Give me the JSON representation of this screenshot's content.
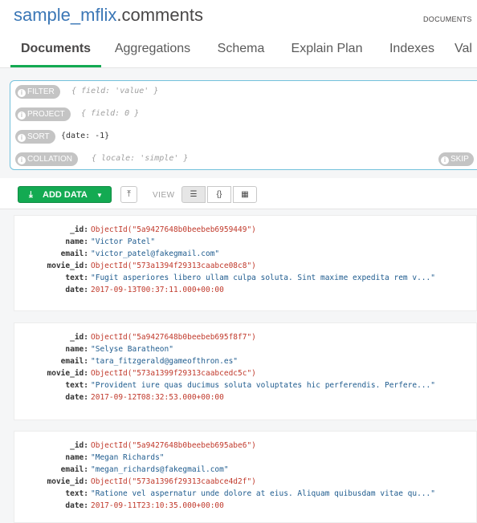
{
  "namespace": {
    "database": "sample_mflix",
    "collection": ".comments",
    "type_label": "DOCUMENTS"
  },
  "tabs": [
    {
      "label": "Documents",
      "active": true
    },
    {
      "label": "Aggregations",
      "active": false
    },
    {
      "label": "Schema",
      "active": false
    },
    {
      "label": "Explain Plan",
      "active": false
    },
    {
      "label": "Indexes",
      "active": false
    },
    {
      "label": "Val",
      "active": false
    }
  ],
  "query": {
    "filter": {
      "label": "FILTER",
      "placeholder": "{ field: 'value' }"
    },
    "project": {
      "label": "PROJECT",
      "placeholder": "{ field: 0 }"
    },
    "sort": {
      "label": "SORT",
      "value": "{date: -1}"
    },
    "collation": {
      "label": "COLLATION",
      "placeholder": "{ locale: 'simple' }"
    },
    "skip": {
      "label": "SKIP"
    },
    "info_icon": "info-icon"
  },
  "toolbar": {
    "add_data_label": "ADD DATA",
    "view_label": "VIEW",
    "add_icon": "download-icon",
    "export_icon": "upload-icon",
    "view_buttons": [
      "list-view-icon",
      "json-view-icon",
      "table-view-icon"
    ],
    "accent_color": "#13aa52"
  },
  "documents": [
    {
      "fields": [
        {
          "key": "_id:",
          "value": "ObjectId(\"5a9427648b0beebeb6959449\")",
          "type": "oid"
        },
        {
          "key": "name:",
          "value": "\"Victor Patel\"",
          "type": "str"
        },
        {
          "key": "email:",
          "value": "\"victor_patel@fakegmail.com\"",
          "type": "str"
        },
        {
          "key": "movie_id:",
          "value": "ObjectId(\"573a1394f29313caabce08c8\")",
          "type": "oid"
        },
        {
          "key": "text:",
          "value": "\"Fugit asperiores libero ullam culpa soluta. Sint maxime expedita rem v...\"",
          "type": "str"
        },
        {
          "key": "date:",
          "value": "2017-09-13T00:37:11.000+00:00",
          "type": "date"
        }
      ]
    },
    {
      "fields": [
        {
          "key": "_id:",
          "value": "ObjectId(\"5a9427648b0beebeb695f8f7\")",
          "type": "oid"
        },
        {
          "key": "name:",
          "value": "\"Selyse Baratheon\"",
          "type": "str"
        },
        {
          "key": "email:",
          "value": "\"tara_fitzgerald@gameofthron.es\"",
          "type": "str"
        },
        {
          "key": "movie_id:",
          "value": "ObjectId(\"573a1399f29313caabcedc5c\")",
          "type": "oid"
        },
        {
          "key": "text:",
          "value": "\"Provident iure quas ducimus soluta voluptates hic perferendis. Perfere...\"",
          "type": "str"
        },
        {
          "key": "date:",
          "value": "2017-09-12T08:32:53.000+00:00",
          "type": "date"
        }
      ]
    },
    {
      "fields": [
        {
          "key": "_id:",
          "value": "ObjectId(\"5a9427648b0beebeb695abe6\")",
          "type": "oid"
        },
        {
          "key": "name:",
          "value": "\"Megan Richards\"",
          "type": "str"
        },
        {
          "key": "email:",
          "value": "\"megan_richards@fakegmail.com\"",
          "type": "str"
        },
        {
          "key": "movie_id:",
          "value": "ObjectId(\"573a1396f29313caabce4d2f\")",
          "type": "oid"
        },
        {
          "key": "text:",
          "value": "\"Ratione vel aspernatur unde dolore at eius. Aliquam quibusdam vitae qu...\"",
          "type": "str"
        },
        {
          "key": "date:",
          "value": "2017-09-11T23:10:35.000+00:00",
          "type": "date"
        }
      ]
    }
  ]
}
